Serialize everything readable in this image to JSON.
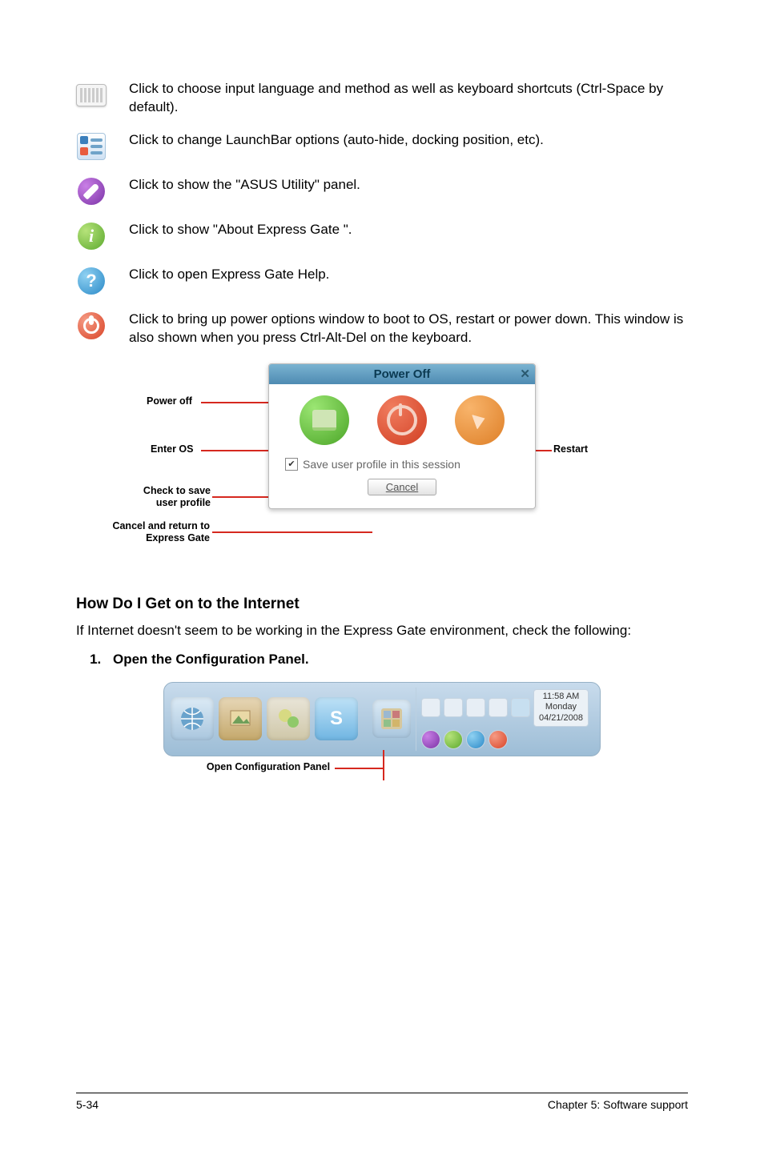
{
  "icons": {
    "keyboard": "Click to choose input language and method as well as keyboard shortcuts (Ctrl-Space by default).",
    "launchbar_opts": "Click to change LaunchBar options (auto-hide, docking position, etc).",
    "asus_utility": "Click to show the \"ASUS Utility\" panel.",
    "about": "Click to show \"About Express Gate \".",
    "help": "Click to open Express Gate  Help.",
    "power": "Click to bring up power options window to boot to OS, restart or power down. This window is also shown when you press Ctrl-Alt-Del on the keyboard."
  },
  "dialog": {
    "title": "Power Off",
    "save_label": "Save user profile in this session",
    "cancel": "Cancel"
  },
  "callouts": {
    "power_off": "Power off",
    "enter_os": "Enter OS",
    "restart": "Restart",
    "check_save_l1": "Check to save",
    "check_save_l2": "user profile",
    "cancel_l1": "Cancel and return to",
    "cancel_l2": "Express Gate"
  },
  "section_heading": "How Do I Get on to the Internet",
  "section_intro": "If Internet doesn't seem to be working in the Express Gate  environment, check the following:",
  "step1": "Open the Configuration Panel.",
  "launchbar": {
    "time": "11:58 AM",
    "day": "Monday",
    "date": "04/21/2008",
    "skype": "S"
  },
  "open_cfg_label": "Open Configuration Panel",
  "footer": {
    "left": "5-34",
    "right": "Chapter 5: Software support"
  }
}
